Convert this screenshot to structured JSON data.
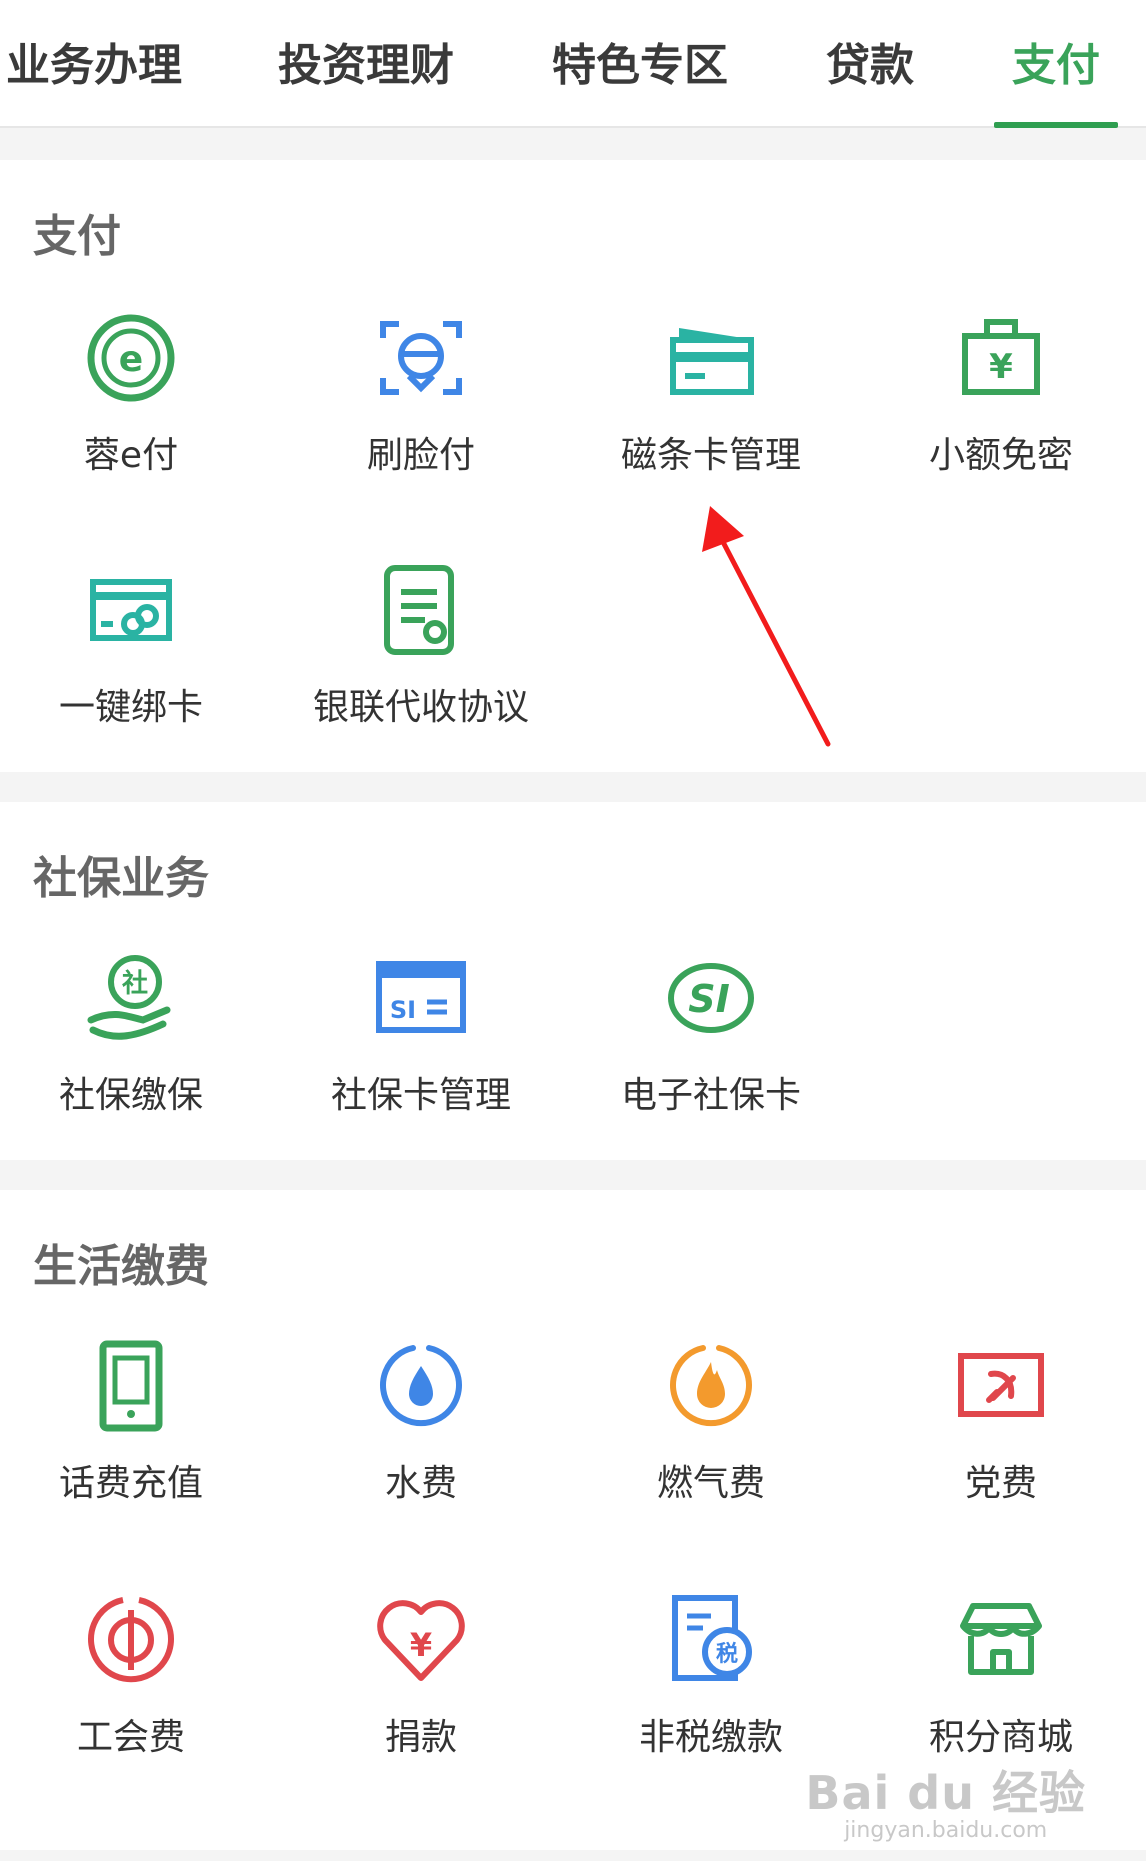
{
  "tabs": [
    {
      "label": "业务办理",
      "active": false
    },
    {
      "label": "投资理财",
      "active": false
    },
    {
      "label": "特色专区",
      "active": false
    },
    {
      "label": "贷款",
      "active": false
    },
    {
      "label": "支付",
      "active": true
    }
  ],
  "sections": {
    "payment": {
      "title": "支付",
      "items": [
        {
          "label": "蓉e付",
          "icon": "rong-e-pay-icon"
        },
        {
          "label": "刷脸付",
          "icon": "face-pay-icon"
        },
        {
          "label": "磁条卡管理",
          "icon": "magnetic-card-icon"
        },
        {
          "label": "小额免密",
          "icon": "small-amount-icon"
        },
        {
          "label": "一键绑卡",
          "icon": "bind-card-icon"
        },
        {
          "label": "银联代收协议",
          "icon": "unionpay-agreement-icon"
        }
      ]
    },
    "social": {
      "title": "社保业务",
      "items": [
        {
          "label": "社保缴保",
          "icon": "social-payment-icon"
        },
        {
          "label": "社保卡管理",
          "icon": "social-card-icon"
        },
        {
          "label": "电子社保卡",
          "icon": "e-social-card-icon"
        }
      ]
    },
    "life": {
      "title": "生活缴费",
      "items": [
        {
          "label": "话费充值",
          "icon": "phone-recharge-icon"
        },
        {
          "label": "水费",
          "icon": "water-icon"
        },
        {
          "label": "燃气费",
          "icon": "gas-icon"
        },
        {
          "label": "党费",
          "icon": "party-fee-icon"
        },
        {
          "label": "工会费",
          "icon": "union-fee-icon"
        },
        {
          "label": "捐款",
          "icon": "donation-icon"
        },
        {
          "label": "非税缴款",
          "icon": "non-tax-icon"
        },
        {
          "label": "积分商城",
          "icon": "points-mall-icon"
        }
      ]
    }
  },
  "icon_glyphs": {
    "rong_e": "e",
    "yen": "¥",
    "social": "社",
    "si": "SI",
    "tax": "税"
  },
  "colors": {
    "accent": "#3aa35a",
    "teal": "#2ab3a3",
    "blue": "#3f86e6",
    "orange": "#f39a2d",
    "red": "#e0474c",
    "annotation_arrow": "#f21c1c"
  },
  "watermark": {
    "logo": "Bai du 经验",
    "url": "jingyan.baidu.com"
  }
}
